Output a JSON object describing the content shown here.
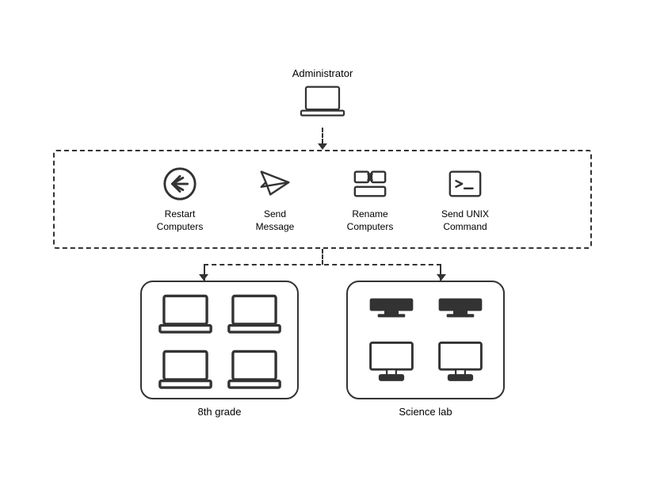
{
  "admin": {
    "label": "Administrator"
  },
  "commands": [
    {
      "id": "restart",
      "label": "Restart\nComputers",
      "icon": "restart"
    },
    {
      "id": "send-message",
      "label": "Send\nMessage",
      "icon": "send"
    },
    {
      "id": "rename",
      "label": "Rename\nComputers",
      "icon": "rename"
    },
    {
      "id": "unix",
      "label": "Send UNIX\nCommand",
      "icon": "terminal"
    }
  ],
  "labs": [
    {
      "id": "8th-grade",
      "label": "8th grade",
      "type": "laptops"
    },
    {
      "id": "science-lab",
      "label": "Science lab",
      "type": "desktops"
    }
  ]
}
